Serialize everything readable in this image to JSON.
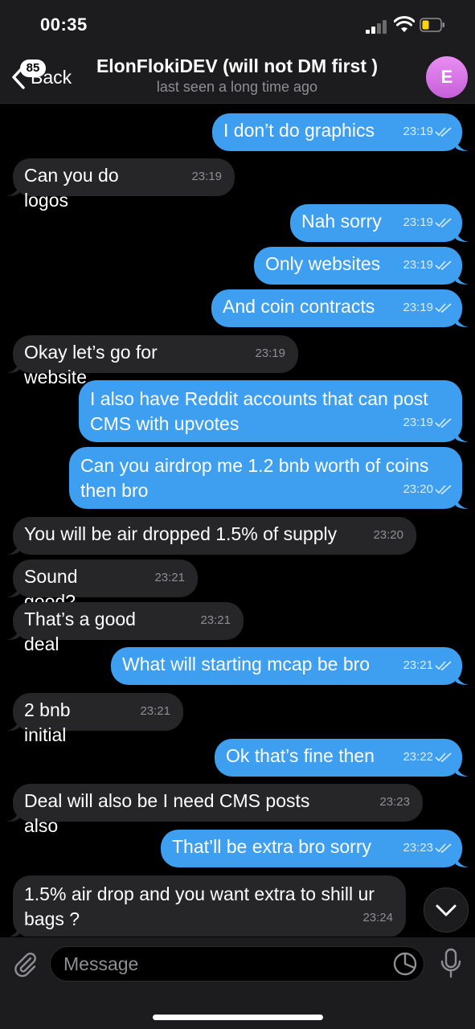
{
  "status_bar": {
    "time": "00:35"
  },
  "header": {
    "back_label": "Back",
    "unread_count": "85",
    "title": "ElonFlokiDEV (will not DM first )",
    "subtitle": "last seen a long time ago",
    "avatar_letter": "E"
  },
  "messages": [
    {
      "dir": "out",
      "text": "I don’t do graphics",
      "time": "23:19",
      "read": true
    },
    {
      "dir": "in",
      "text": "Can you do logos",
      "time": "23:19"
    },
    {
      "dir": "out",
      "text": "Nah sorry",
      "time": "23:19",
      "read": true
    },
    {
      "dir": "out",
      "text": "Only websites",
      "time": "23:19",
      "read": true
    },
    {
      "dir": "out",
      "text": "And coin contracts",
      "time": "23:19",
      "read": true
    },
    {
      "dir": "in",
      "text": "Okay let’s go for website",
      "time": "23:19"
    },
    {
      "dir": "out",
      "text": "I also have Reddit accounts that can post CMS with upvotes",
      "time": "23:19",
      "read": true
    },
    {
      "dir": "out",
      "text": "Can you airdrop me 1.2 bnb worth of coins then bro",
      "time": "23:20",
      "read": true
    },
    {
      "dir": "in",
      "text": "You will be air dropped 1.5% of supply",
      "time": "23:20"
    },
    {
      "dir": "in",
      "text": "Sound good?",
      "time": "23:21"
    },
    {
      "dir": "in",
      "text": "That’s a good deal",
      "time": "23:21"
    },
    {
      "dir": "out",
      "text": "What will starting mcap be bro",
      "time": "23:21",
      "read": true
    },
    {
      "dir": "in",
      "text": "2 bnb initial",
      "time": "23:21"
    },
    {
      "dir": "out",
      "text": "Ok that’s fine then",
      "time": "23:22",
      "read": true
    },
    {
      "dir": "in",
      "text": "Deal will also be I need CMS posts also",
      "time": "23:23"
    },
    {
      "dir": "out",
      "text": "That’ll be extra bro sorry",
      "time": "23:23",
      "read": true
    },
    {
      "dir": "in",
      "text": "1.5% air drop and you want extra to shill ur bags ?",
      "time": "23:24"
    }
  ],
  "composer": {
    "placeholder": "Message",
    "value": ""
  },
  "colors": {
    "outgoing_bubble": "#3e9ff0",
    "incoming_bubble": "#262628",
    "background": "#000000"
  }
}
